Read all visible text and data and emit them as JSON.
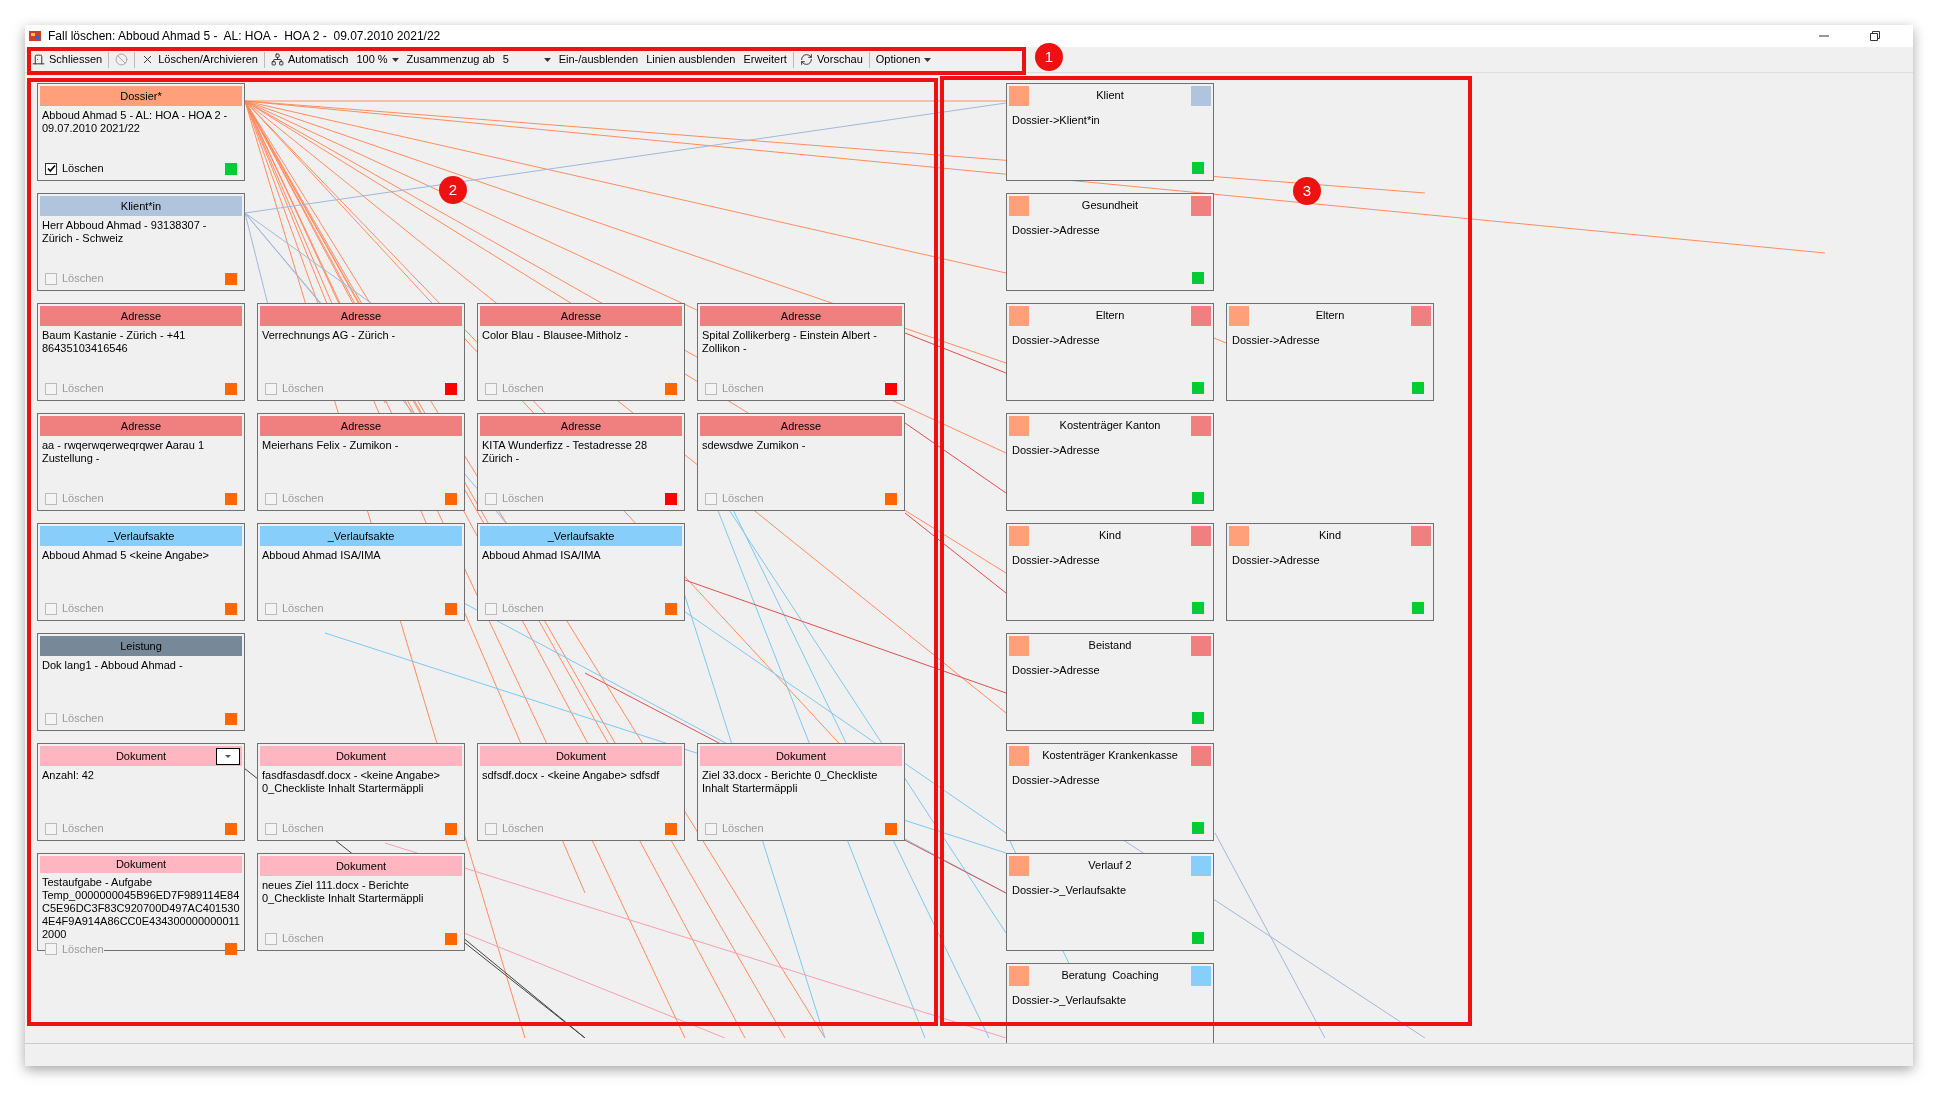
{
  "window": {
    "title": "Fall löschen: Abboud Ahmad 5 -  AL: HOA -  HOA 2 -  09.07.2010 2021/22"
  },
  "toolbar": {
    "groups": [
      [
        {
          "kind": "button",
          "label": "Schliessen",
          "disabled": false
        }
      ],
      [
        {
          "kind": "icon-button",
          "disabled": true
        }
      ],
      [
        {
          "kind": "button",
          "label": "Löschen/Archivieren",
          "disabled": false
        }
      ],
      [
        {
          "kind": "button",
          "label": "Automatisch",
          "disabled": false
        },
        {
          "kind": "dropdown",
          "label": "100 %",
          "disabled": false
        },
        {
          "kind": "label",
          "label": "Zusammenzug ab",
          "disabled": false
        },
        {
          "kind": "combo",
          "label": "5",
          "disabled": false
        },
        {
          "kind": "button",
          "label": "Ein-/ausblenden",
          "disabled": false
        },
        {
          "kind": "button",
          "label": "Linien ausblenden",
          "disabled": false
        },
        {
          "kind": "button",
          "label": "Erweitert",
          "disabled": false
        }
      ],
      [
        {
          "kind": "button",
          "label": "Vorschau",
          "disabled": false
        }
      ],
      [
        {
          "kind": "dropdown",
          "label": "Optionen",
          "disabled": false
        }
      ]
    ]
  },
  "left_rows": [
    [
      {
        "header": "Dossier*",
        "color": "#ffa07a",
        "text": "Abboud Ahmad 5 -  AL: HOA -  HOA 2 -  09.07.2010 2021/22",
        "checkbox": "Löschen",
        "checked": true,
        "disabled": false,
        "status": {
          "color": "#00cc33"
        },
        "dropdown": false
      }
    ],
    [
      {
        "header": "Klient*in",
        "color": "#b0c4de",
        "text": "Herr Abboud Ahmad -  93138307 -  Zürich -  Schweiz",
        "checkbox": "Löschen",
        "checked": false,
        "disabled": true,
        "status": {
          "color": "#ff6600"
        },
        "dropdown": false
      }
    ],
    [
      {
        "header": "Adresse",
        "color": "#f08080",
        "text": "Baum Kastanie -  Zürich -  +41 86435103416546",
        "checkbox": "Löschen",
        "checked": false,
        "disabled": true,
        "status": {
          "color": "#ff6600"
        },
        "dropdown": false
      },
      {
        "header": "Adresse",
        "color": "#f08080",
        "text": "Verrechnungs AG -  Zürich -",
        "checkbox": "Löschen",
        "checked": false,
        "disabled": true,
        "status": {
          "color": "#ff0000"
        },
        "dropdown": false
      },
      {
        "header": "Adresse",
        "color": "#f08080",
        "text": "Color Blau -  Blausee-Mitholz -",
        "checkbox": "Löschen",
        "checked": false,
        "disabled": true,
        "status": {
          "color": "#ff6600"
        },
        "dropdown": false
      },
      {
        "header": "Adresse",
        "color": "#f08080",
        "text": "Spital Zollikerberg -  Einstein Albert -  Zollikon -",
        "checkbox": "Löschen",
        "checked": false,
        "disabled": true,
        "status": {
          "color": "#ff0000"
        },
        "dropdown": false
      }
    ],
    [
      {
        "header": "Adresse",
        "color": "#f08080",
        "text": "aa -  rwqerwqerweqrqwer Aarau 1 Zustellung -",
        "checkbox": "Löschen",
        "checked": false,
        "disabled": true,
        "status": {
          "color": "#ff6600"
        },
        "dropdown": false
      },
      {
        "header": "Adresse",
        "color": "#f08080",
        "text": "Meierhans Felix -  Zumikon -",
        "checkbox": "Löschen",
        "checked": false,
        "disabled": true,
        "status": {
          "color": "#ff6600"
        },
        "dropdown": false
      },
      {
        "header": "Adresse",
        "color": "#f08080",
        "text": "KITA Wunderfizz -  Testadresse 28 Zürich -",
        "checkbox": "Löschen",
        "checked": false,
        "disabled": true,
        "status": {
          "color": "#ff0000"
        },
        "dropdown": false
      },
      {
        "header": "Adresse",
        "color": "#f08080",
        "text": "sdewsdwe Zumikon -",
        "checkbox": "Löschen",
        "checked": false,
        "disabled": true,
        "status": {
          "color": "#ff6600"
        },
        "dropdown": false
      }
    ],
    [
      {
        "header": "_Verlaufsakte",
        "color": "#87cefa",
        "text": "Abboud Ahmad 5 <keine Angabe>",
        "checkbox": "Löschen",
        "checked": false,
        "disabled": true,
        "status": {
          "color": "#ff6600"
        },
        "dropdown": false
      },
      {
        "header": "_Verlaufsakte",
        "color": "#87cefa",
        "text": "Abboud Ahmad ISA/IMA",
        "checkbox": "Löschen",
        "checked": false,
        "disabled": true,
        "status": {
          "color": "#ff6600"
        },
        "dropdown": false
      },
      {
        "header": "_Verlaufsakte",
        "color": "#87cefa",
        "text": "Abboud Ahmad ISA/IMA",
        "checkbox": "Löschen",
        "checked": false,
        "disabled": true,
        "status": {
          "color": "#ff6600"
        },
        "dropdown": false
      }
    ],
    [
      {
        "header": "Leistung",
        "color": "#778899",
        "text": "Dok lang1 -  Abboud Ahmad -",
        "checkbox": "Löschen",
        "checked": false,
        "disabled": true,
        "status": {
          "color": "#ff6600"
        },
        "dropdown": false
      }
    ],
    [
      {
        "header": "Dokument",
        "color": "#ffb6c1",
        "text": "Anzahl: 42",
        "checkbox": "Löschen",
        "checked": false,
        "disabled": true,
        "status": {
          "color": "#ff6600"
        },
        "dropdown": true
      },
      {
        "header": "Dokument",
        "color": "#ffb6c1",
        "text": "fasdfasdasdf.docx -  <keine Angabe> 0_Checkliste Inhalt Startermäppli",
        "checkbox": "Löschen",
        "checked": false,
        "disabled": true,
        "status": {
          "color": "#ff6600"
        },
        "dropdown": false
      },
      {
        "header": "Dokument",
        "color": "#ffb6c1",
        "text": "sdfsdf.docx -  <keine Angabe> sdfsdf",
        "checkbox": "Löschen",
        "checked": false,
        "disabled": true,
        "status": {
          "color": "#ff6600"
        },
        "dropdown": false
      },
      {
        "header": "Dokument",
        "color": "#ffb6c1",
        "text": "Ziel 33.docx -  Berichte 0_Checkliste Inhalt Startermäppli",
        "checkbox": "Löschen",
        "checked": false,
        "disabled": true,
        "status": {
          "color": "#ff6600"
        },
        "dropdown": false
      }
    ],
    [
      {
        "header": "Dokument",
        "color": "#ffb6c1",
        "text": "Testaufgabe -  Aufgabe Temp_0000000045B96ED7F989114E84C5E96DC3F83C920700D497AC4015304E4F9A914A86CC0E4343000000000112000",
        "checkbox": "Löschen",
        "checked": false,
        "disabled": true,
        "status": {
          "color": "#ff6600"
        },
        "dropdown": false
      },
      {
        "header": "Dokument",
        "color": "#ffb6c1",
        "text": "neues Ziel 111.docx -  Berichte 0_Checkliste Inhalt Startermäppli",
        "checkbox": "Löschen",
        "checked": false,
        "disabled": true,
        "status": {
          "color": "#ff6600"
        },
        "dropdown": false
      }
    ]
  ],
  "right_rows": [
    [
      {
        "title": "Klient",
        "source": {
          "color": "#ffa07a"
        },
        "target": {
          "color": "#b0c4de"
        },
        "text": "Dossier->Klient*in",
        "status": {
          "color": "#00cc33"
        }
      }
    ],
    [
      {
        "title": "Gesundheit",
        "source": {
          "color": "#ffa07a"
        },
        "target": {
          "color": "#f08080"
        },
        "text": "Dossier->Adresse",
        "status": {
          "color": "#00cc33"
        }
      }
    ],
    [
      {
        "title": "Eltern",
        "source": {
          "color": "#ffa07a"
        },
        "target": {
          "color": "#f08080"
        },
        "text": "Dossier->Adresse",
        "status": {
          "color": "#00cc33"
        }
      },
      {
        "title": "Eltern",
        "source": {
          "color": "#ffa07a"
        },
        "target": {
          "color": "#f08080"
        },
        "text": "Dossier->Adresse",
        "status": {
          "color": "#00cc33"
        }
      }
    ],
    [
      {
        "title": "Kostenträger Kanton",
        "source": {
          "color": "#ffa07a"
        },
        "target": {
          "color": "#f08080"
        },
        "text": "Dossier->Adresse",
        "status": {
          "color": "#00cc33"
        }
      }
    ],
    [
      {
        "title": "Kind",
        "source": {
          "color": "#ffa07a"
        },
        "target": {
          "color": "#f08080"
        },
        "text": "Dossier->Adresse",
        "status": {
          "color": "#00cc33"
        }
      },
      {
        "title": "Kind",
        "source": {
          "color": "#ffa07a"
        },
        "target": {
          "color": "#f08080"
        },
        "text": "Dossier->Adresse",
        "status": {
          "color": "#00cc33"
        }
      }
    ],
    [
      {
        "title": "Beistand",
        "source": {
          "color": "#ffa07a"
        },
        "target": {
          "color": "#f08080"
        },
        "text": "Dossier->Adresse",
        "status": {
          "color": "#00cc33"
        }
      }
    ],
    [
      {
        "title": "Kostenträger Krankenkasse",
        "source": {
          "color": "#ffa07a"
        },
        "target": {
          "color": "#f08080"
        },
        "text": "Dossier->Adresse",
        "status": {
          "color": "#00cc33"
        }
      }
    ],
    [
      {
        "title": "Verlauf 2",
        "source": {
          "color": "#ffa07a"
        },
        "target": {
          "color": "#87cefa"
        },
        "text": "Dossier->_Verlaufsakte",
        "status": {
          "color": "#00cc33"
        }
      }
    ],
    [
      {
        "title": "Beratung  Coaching",
        "source": {
          "color": "#ffa07a"
        },
        "target": {
          "color": "#87cefa"
        },
        "text": "Dossier->_Verlaufsakte"
      }
    ]
  ],
  "annotations": [
    {
      "label": "1"
    },
    {
      "label": "2"
    },
    {
      "label": "3"
    }
  ]
}
